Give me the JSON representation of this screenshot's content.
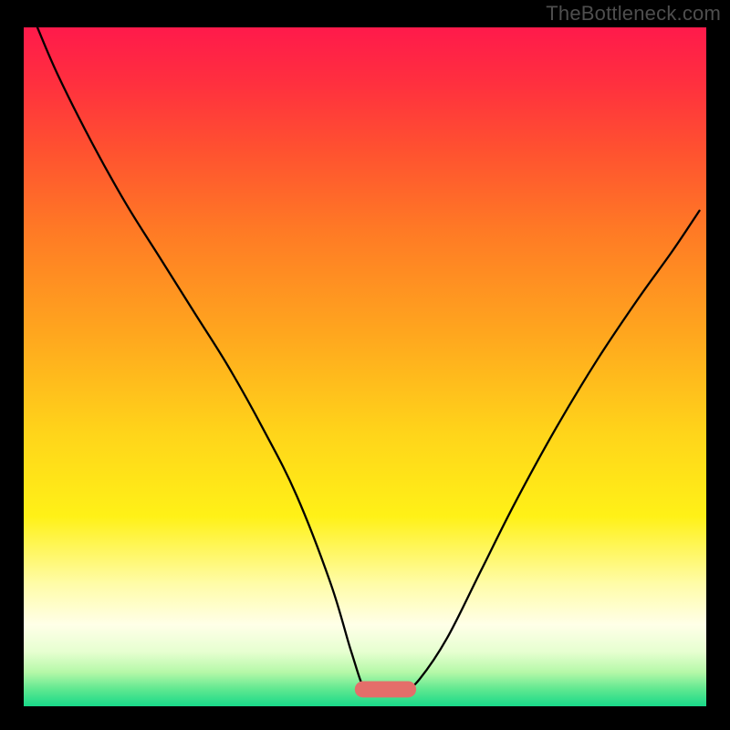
{
  "watermark": "TheBottleneck.com",
  "chart_data": {
    "type": "line",
    "title": "",
    "xlabel": "",
    "ylabel": "",
    "xlim": [
      0,
      100
    ],
    "ylim": [
      0,
      100
    ],
    "background_gradient": {
      "stops": [
        {
          "offset": 0.0,
          "color": "#ff1a4b"
        },
        {
          "offset": 0.08,
          "color": "#ff2f3f"
        },
        {
          "offset": 0.18,
          "color": "#ff5130"
        },
        {
          "offset": 0.3,
          "color": "#ff7a25"
        },
        {
          "offset": 0.45,
          "color": "#ffa61e"
        },
        {
          "offset": 0.6,
          "color": "#ffd51a"
        },
        {
          "offset": 0.72,
          "color": "#fff117"
        },
        {
          "offset": 0.82,
          "color": "#fffca8"
        },
        {
          "offset": 0.88,
          "color": "#ffffe8"
        },
        {
          "offset": 0.92,
          "color": "#e6ffd0"
        },
        {
          "offset": 0.95,
          "color": "#b5f8a8"
        },
        {
          "offset": 0.975,
          "color": "#5fe890"
        },
        {
          "offset": 1.0,
          "color": "#18d989"
        }
      ]
    },
    "series": [
      {
        "name": "bottleneck-curve",
        "color": "#000000",
        "width": 2.3,
        "x": [
          2,
          5,
          10,
          15,
          20,
          25,
          30,
          35,
          40,
          45,
          48,
          50,
          52,
          54,
          56,
          58,
          62,
          67,
          72,
          78,
          84,
          90,
          95,
          99
        ],
        "y": [
          100,
          93,
          83,
          74,
          66,
          58,
          50,
          41,
          31,
          18,
          8,
          2.5,
          2.5,
          2.5,
          2.5,
          4,
          10,
          20,
          30,
          41,
          51,
          60,
          67,
          73
        ]
      }
    ],
    "marker": {
      "name": "bottleneck-marker",
      "x_center": 53,
      "y": 2.5,
      "width": 9,
      "height": 2.4,
      "color": "#e46e6a"
    }
  }
}
